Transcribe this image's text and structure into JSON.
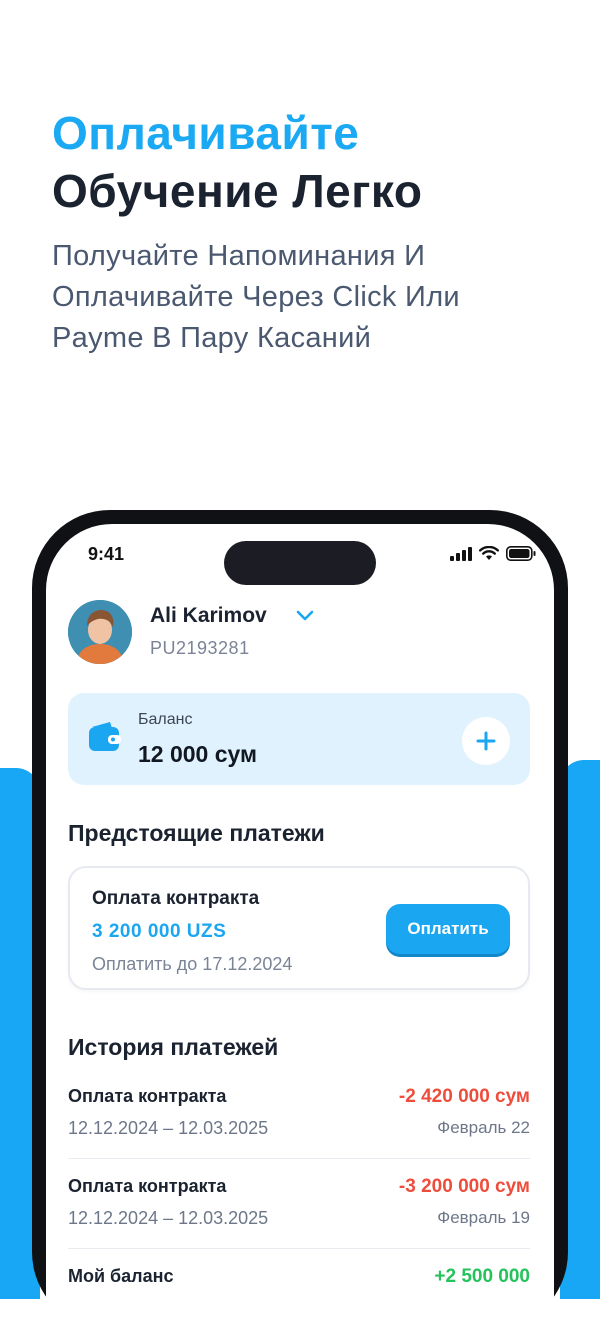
{
  "promo": {
    "title_line1": "Оплачивайте",
    "title_line2": "Обучение Легко",
    "subtitle_line1": "Получайте Напоминания И",
    "subtitle_line2": "Оплачивайте Через Click Или",
    "subtitle_line3": "Payme В Пару Касаний"
  },
  "status_bar": {
    "time": "9:41"
  },
  "user": {
    "name": "Ali Karimov",
    "id": "PU2193281"
  },
  "balance": {
    "label": "Баланс",
    "value": "12 000 сум"
  },
  "upcoming": {
    "section_title": "Предстоящие платежи",
    "item": {
      "title": "Оплата контракта",
      "amount": "3 200 000 UZS",
      "due": "Оплатить до 17.12.2024",
      "pay_label": "Оплатить"
    }
  },
  "history": {
    "section_title": "История платежей",
    "items": [
      {
        "title": "Оплата контракта",
        "dates": "12.12.2024 – 12.03.2025",
        "amount": "-2 420 000 сум",
        "date": "Февраль 22",
        "kind": "negative"
      },
      {
        "title": "Оплата контракта",
        "dates": "12.12.2024 – 12.03.2025",
        "amount": "-3 200 000 сум",
        "date": "Февраль 19",
        "kind": "negative"
      },
      {
        "title": "Мой баланс",
        "dates": "",
        "amount": "+2 500 000",
        "date": "",
        "kind": "positive"
      }
    ]
  },
  "colors": {
    "accent": "#1aa9f2",
    "negative": "#ef4d3c",
    "positive": "#23c25a"
  },
  "icons": {
    "chevron": "chevron-down-icon",
    "wallet": "wallet-icon",
    "add": "plus-icon",
    "signal": "signal-icon",
    "wifi": "wifi-icon",
    "battery": "battery-icon"
  }
}
